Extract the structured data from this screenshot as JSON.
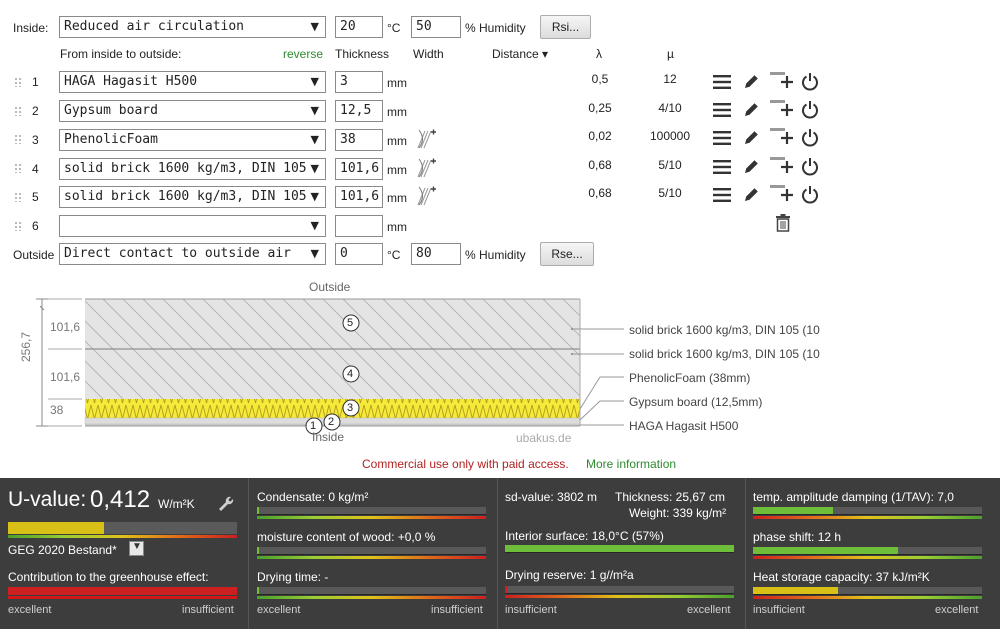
{
  "inside": {
    "label": "Inside:",
    "condition": "Reduced air circulation",
    "temp": "20",
    "temp_unit": "°C",
    "humidity": "50",
    "humidity_unit": "% Humidity",
    "button": "Rsi..."
  },
  "outside": {
    "label": "Outside",
    "condition": "Direct contact to outside air",
    "temp": "0",
    "temp_unit": "°C",
    "humidity": "80",
    "humidity_unit": "% Humidity",
    "button": "Rse..."
  },
  "table_header": {
    "order": "From inside to outside:",
    "reverse": "reverse",
    "thickness": "Thickness",
    "width": "Width",
    "distance": "Distance ▾",
    "lambda": "λ",
    "mu": "µ"
  },
  "unit_mm": "mm",
  "layers": [
    {
      "num": "1",
      "material": "HAGA Hagasit H500",
      "thickness": "3",
      "lambda": "0,5",
      "mu": "12"
    },
    {
      "num": "2",
      "material": "Gypsum board",
      "thickness": "12,5",
      "lambda": "0,25",
      "mu": "4/10"
    },
    {
      "num": "3",
      "material": "PhenolicFoam",
      "thickness": "38",
      "lambda": "0,02",
      "mu": "100000"
    },
    {
      "num": "4",
      "material": "solid brick 1600 kg/m3, DIN 105",
      "thickness": "101,6",
      "lambda": "0,68",
      "mu": "5/10"
    },
    {
      "num": "5",
      "material": "solid brick 1600 kg/m3, DIN 105",
      "thickness": "101,6",
      "lambda": "0,68",
      "mu": "5/10"
    },
    {
      "num": "6",
      "material": "",
      "thickness": "",
      "lambda": "",
      "mu": ""
    }
  ],
  "diagram": {
    "outside_label": "Outside",
    "inside_label": "Inside",
    "watermark": "ubakus.de",
    "total": "256,7",
    "dim_labels": [
      "101,6",
      "101,6",
      "38"
    ],
    "circle_labels": [
      "5",
      "4",
      "3",
      "2",
      "1"
    ],
    "legend": [
      "solid brick 1600 kg/m3, DIN 105 (10",
      "solid brick 1600 kg/m3, DIN 105 (10",
      "PhenolicFoam (38mm)",
      "Gypsum board (12,5mm)",
      "HAGA Hagasit H500"
    ],
    "commercial_text": "Commercial use only with paid access.",
    "more_info": "More information"
  },
  "results": {
    "uvalue_label": "U-value:",
    "uvalue": "0,412",
    "uvalue_unit": "W/m²K",
    "uvalue_fraction": 0.42,
    "standard": "GEG 2020 Bestand*",
    "greenhouse": "Contribution to the greenhouse effect:",
    "condensate": "Condensate: 0 kg/m²",
    "moisture": "moisture content of wood: +0,0 %",
    "drying_time": "Drying time: -",
    "sd_value": "sd-value: 3802 m",
    "thickness": "Thickness: 25,67 cm",
    "weight": "Weight: 339 kg/m²",
    "interior_surface": "Interior surface: 18,0°C (57%)",
    "drying_reserve": "Drying reserve: 1 g//m²a",
    "temp_amplitude": "temp. amplitude damping (1/TAV): 7,0",
    "phase_shift": "phase shift: 12 h",
    "heat_storage": "Heat storage capacity: 37 kJ/m²K",
    "scale_excellent": "excellent",
    "scale_insufficient": "insufficient"
  },
  "colors": {
    "accent_green": "#2e8b2e",
    "warning_red": "#b22222",
    "panel_bg": "#3d3d3d",
    "foam_yellow": "#f3ea3a"
  }
}
